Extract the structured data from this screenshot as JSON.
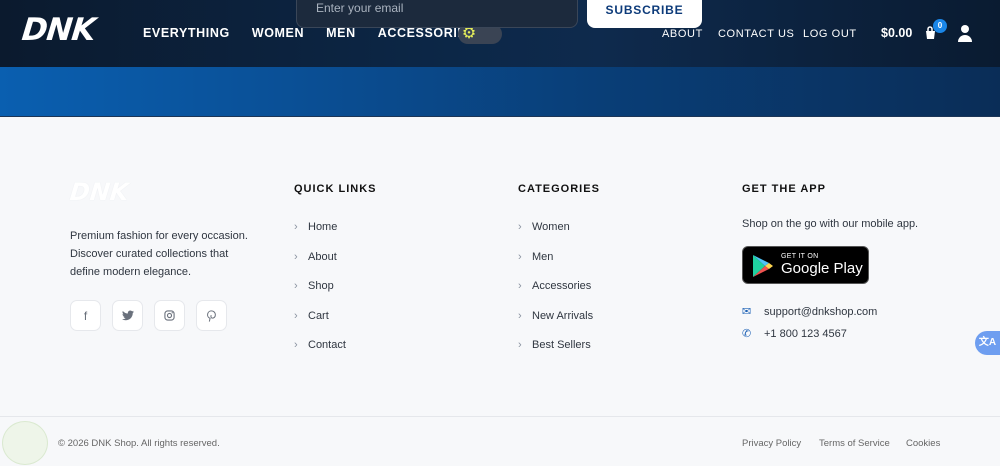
{
  "brand": {
    "logo": "DNK"
  },
  "nav": {
    "items": [
      "EVERYTHING",
      "WOMEN",
      "MEN",
      "ACCESSORIES"
    ]
  },
  "newsletter": {
    "placeholder": "Enter your email",
    "button": "SUBSCRIBE"
  },
  "right_nav": {
    "about": "ABOUT",
    "contact": "CONTACT US",
    "logout": "LOG OUT"
  },
  "cart": {
    "total": "$0.00",
    "count": "0"
  },
  "footer": {
    "logo": "DNK",
    "tagline": "Premium fashion for every occasion. Discover curated collections that define modern elegance.",
    "quick_links": {
      "title": "QUICK LINKS",
      "items": [
        "Home",
        "About",
        "Shop",
        "Cart",
        "Contact"
      ]
    },
    "categories": {
      "title": "CATEGORIES",
      "items": [
        "Women",
        "Men",
        "Accessories",
        "New Arrivals",
        "Best Sellers"
      ]
    },
    "app": {
      "title": "GET THE APP",
      "text": "Shop on the go with our mobile app.",
      "badge_small": "GET IT ON",
      "badge_big": "Google Play",
      "email": "support@dnkshop.com",
      "phone": "+1 800 123 4567"
    },
    "copyright": "© 2026 DNK Shop. All rights reserved.",
    "legal": [
      "Privacy Policy",
      "Terms of Service",
      "Cookies"
    ]
  },
  "colors": {
    "header_bg": "#0c2747",
    "accent": "#1a86e8",
    "toggle_icon": "#e9f25a"
  }
}
